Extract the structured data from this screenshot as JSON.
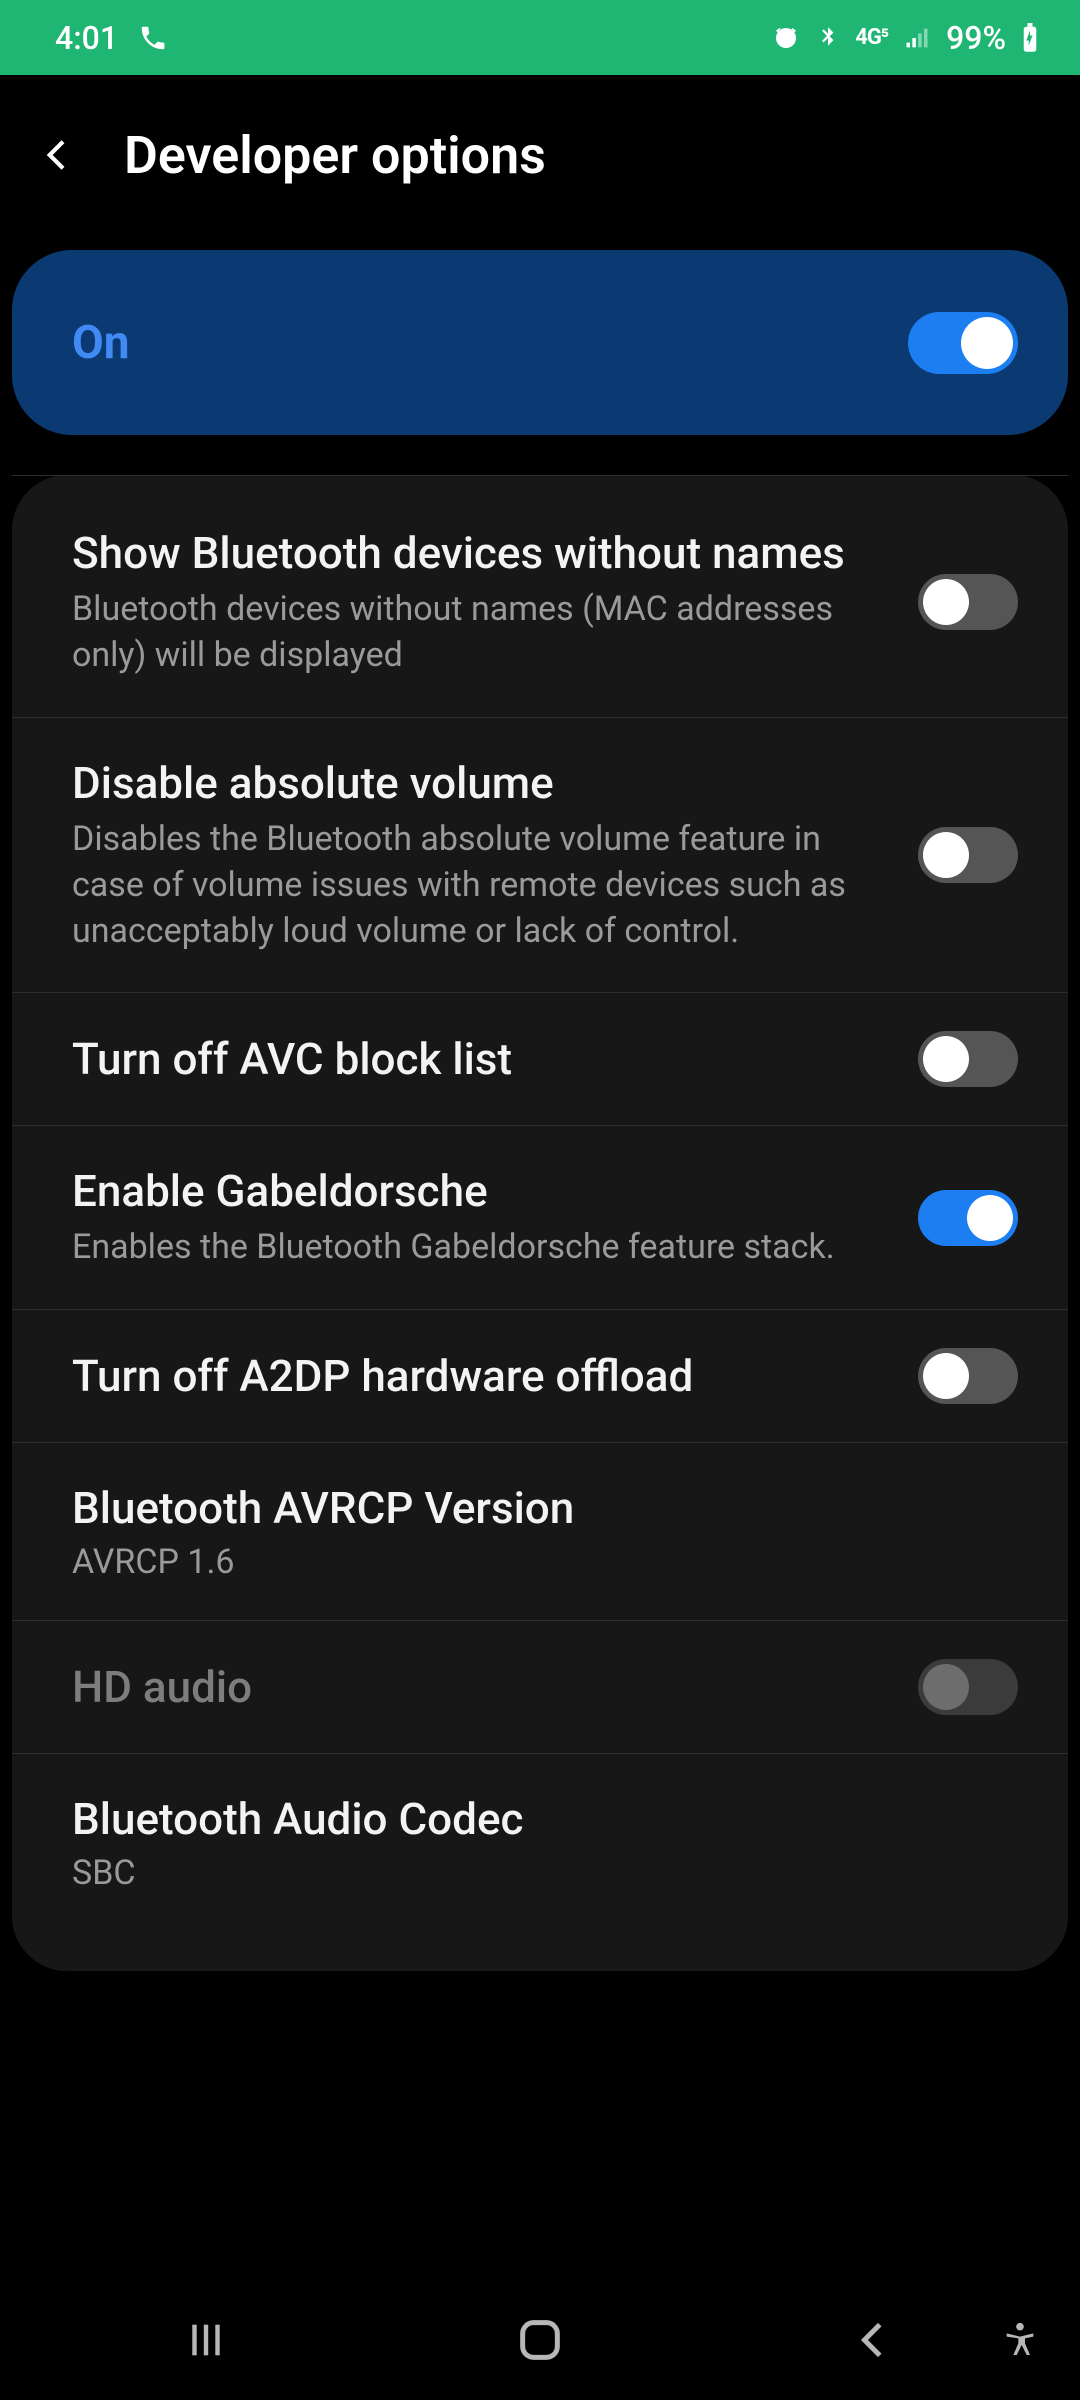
{
  "status": {
    "time": "4:01",
    "battery": "99%"
  },
  "page_title": "Developer options",
  "master": {
    "label": "On",
    "state": "on"
  },
  "rows": [
    {
      "title": "Show Bluetooth devices without names",
      "sub": "Bluetooth devices without names (MAC addresses only) will be displayed",
      "toggle": "off"
    },
    {
      "title": "Disable absolute volume",
      "sub": "Disables the Bluetooth absolute volume feature in case of volume issues with remote devices such as unacceptably loud volume or lack of control.",
      "toggle": "off"
    },
    {
      "title": "Turn off AVC block list",
      "toggle": "off"
    },
    {
      "title": "Enable Gabeldorsche",
      "sub": "Enables the Bluetooth Gabeldorsche feature stack.",
      "toggle": "on"
    },
    {
      "title": "Turn off A2DP hardware offload",
      "toggle": "off"
    },
    {
      "title": "Bluetooth AVRCP Version",
      "value": "AVRCP 1.6"
    },
    {
      "title": "HD audio",
      "toggle": "disabled",
      "disabled": true
    },
    {
      "title": "Bluetooth Audio Codec",
      "value": "SBC"
    }
  ]
}
